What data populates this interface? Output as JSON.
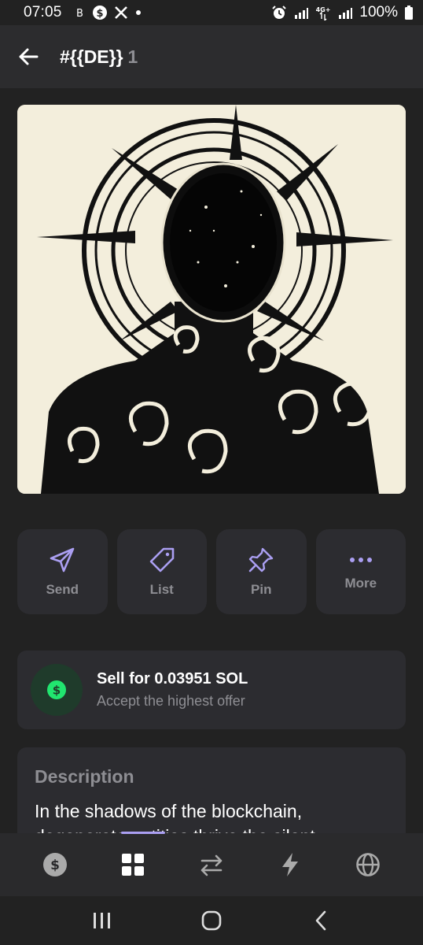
{
  "status_bar": {
    "time": "07:05",
    "battery": "100%",
    "network": "4G+"
  },
  "header": {
    "title": "#{{DE}}",
    "count": "1"
  },
  "actions": [
    {
      "label": "Send",
      "icon": "send-icon"
    },
    {
      "label": "List",
      "icon": "tag-icon"
    },
    {
      "label": "Pin",
      "icon": "pin-icon"
    },
    {
      "label": "More",
      "icon": "more-icon"
    }
  ],
  "sell": {
    "title": "Sell for 0.03951 SOL",
    "subtitle": "Accept the highest offer",
    "icon": "dollar-icon"
  },
  "description": {
    "heading": "Description",
    "text": "In the shadows of the blockchain, degenerate entities thrive the silent..."
  },
  "tabs": [
    {
      "icon": "wallet-icon"
    },
    {
      "icon": "collectibles-icon",
      "active": true
    },
    {
      "icon": "swap-icon"
    },
    {
      "icon": "activity-icon"
    },
    {
      "icon": "explore-icon"
    }
  ],
  "colors": {
    "accent": "#ab9ff2",
    "background": "#222222",
    "card": "#2c2c30",
    "muted": "#8e8e93",
    "success": "#21e56f"
  }
}
